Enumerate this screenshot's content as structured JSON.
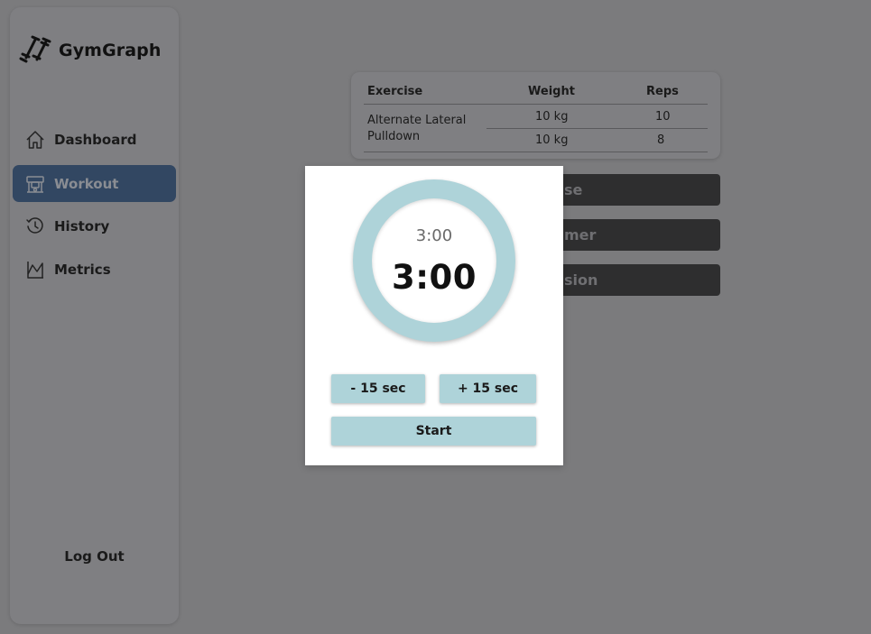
{
  "brand": {
    "name": "GymGraph",
    "icon": "dumbbell-icon"
  },
  "nav": {
    "items": [
      {
        "label": "Dashboard",
        "icon": "home-icon",
        "active": false
      },
      {
        "label": "Workout",
        "icon": "workout-machine-icon",
        "active": true
      },
      {
        "label": "History",
        "icon": "history-icon",
        "active": false
      },
      {
        "label": "Metrics",
        "icon": "chart-icon",
        "active": false
      }
    ],
    "logout": "Log Out"
  },
  "exercise_table": {
    "headers": {
      "exercise": "Exercise",
      "weight": "Weight",
      "reps": "Reps"
    },
    "exercise_name_line1": "Alternate Lateral",
    "exercise_name_line2": "Pulldown",
    "sets": [
      {
        "weight": "10 kg",
        "reps": "10"
      },
      {
        "weight": "10 kg",
        "reps": "8"
      }
    ]
  },
  "background_buttons": {
    "b1": "se",
    "b2": "mer",
    "b3": "sion"
  },
  "timer_modal": {
    "set_time": "3:00",
    "remaining": "3:00",
    "minus_label": "- 15 sec",
    "plus_label": "+ 15 sec",
    "start_label": "Start"
  },
  "colors": {
    "accent": "#aed3d9",
    "active_nav": "#324762",
    "overlay_background": "#7b7b7d"
  }
}
